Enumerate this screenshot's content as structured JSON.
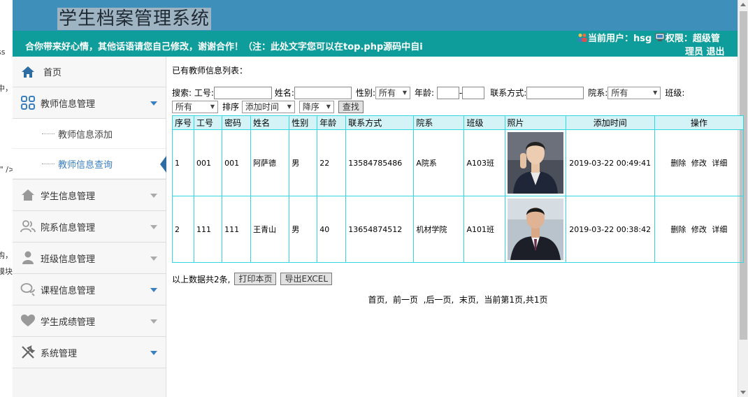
{
  "edge_fragments": [
    "ss",
    "中，",
    ";\" />",
    "购，",
    "膜块"
  ],
  "header": {
    "title": "学生档案管理系统",
    "marquee": "合你带来好心情，其他话语请您自己修改，谢谢合作！（注：此处文字您可以在top.php源码中自i",
    "user_label": "当前用户：hsg",
    "role_label": "权限：超级管",
    "role_label_2": "理员",
    "logout": "退出"
  },
  "sidebar": {
    "home": "首页",
    "teacher": "教师信息管理",
    "teacher_sub": [
      "教师信息添加",
      "教师信息查询"
    ],
    "items": [
      "学生信息管理",
      "院系信息管理",
      "班级信息管理",
      "课程信息管理",
      "学生成绩管理",
      "系统管理"
    ]
  },
  "main": {
    "caption": "已有教师信息列表：",
    "search": {
      "label": "搜索:",
      "id_label": "工号:",
      "name_label": "姓名:",
      "gender_label": "性别:",
      "gender_value": "所有",
      "age_label": "年龄:",
      "age_sep": "-",
      "contact_label": "联系方式:",
      "dept_label": "院系:",
      "dept_value": "所有",
      "class_label": "班级:",
      "class_value": "所有",
      "sort_label": "排序",
      "sort_value": "添加时间",
      "order_value": "降序",
      "search_btn": "查找"
    },
    "table": {
      "headers": [
        "序号",
        "工号",
        "密码",
        "姓名",
        "性别",
        "年龄",
        "联系方式",
        "院系",
        "班级",
        "照片",
        "添加时间",
        "操作"
      ],
      "rows": [
        {
          "no": "1",
          "id": "001",
          "pwd": "001",
          "name": "阿萨德",
          "gender": "男",
          "age": "22",
          "contact": "13584785486",
          "dept": "A院系",
          "cls": "A103班",
          "time": "2019-03-22 00:49:41",
          "ops": [
            "删除",
            "修改",
            "详细"
          ]
        },
        {
          "no": "2",
          "id": "111",
          "pwd": "111",
          "name": "王青山",
          "gender": "男",
          "age": "40",
          "contact": "13654874512",
          "dept": "机材学院",
          "cls": "A101班",
          "time": "2019-03-22 00:38:42",
          "ops": [
            "删除",
            "修改",
            "详细"
          ]
        }
      ]
    },
    "summary": "以上数据共2条,",
    "print_btn": "打印本页",
    "export_btn": "导出EXCEL",
    "pager": {
      "first": "首页,",
      "prev": "前一页",
      "next": ",后一页,",
      "last": "末页,",
      "current": "当前第1页,共1页"
    }
  },
  "colors": {
    "header_blue": "#3e8fb9",
    "header_band": "#0f9d9b",
    "grid_border": "#33d6e0",
    "grid_header": "#d4f3f7",
    "nav_accent": "#3a7fc0"
  }
}
